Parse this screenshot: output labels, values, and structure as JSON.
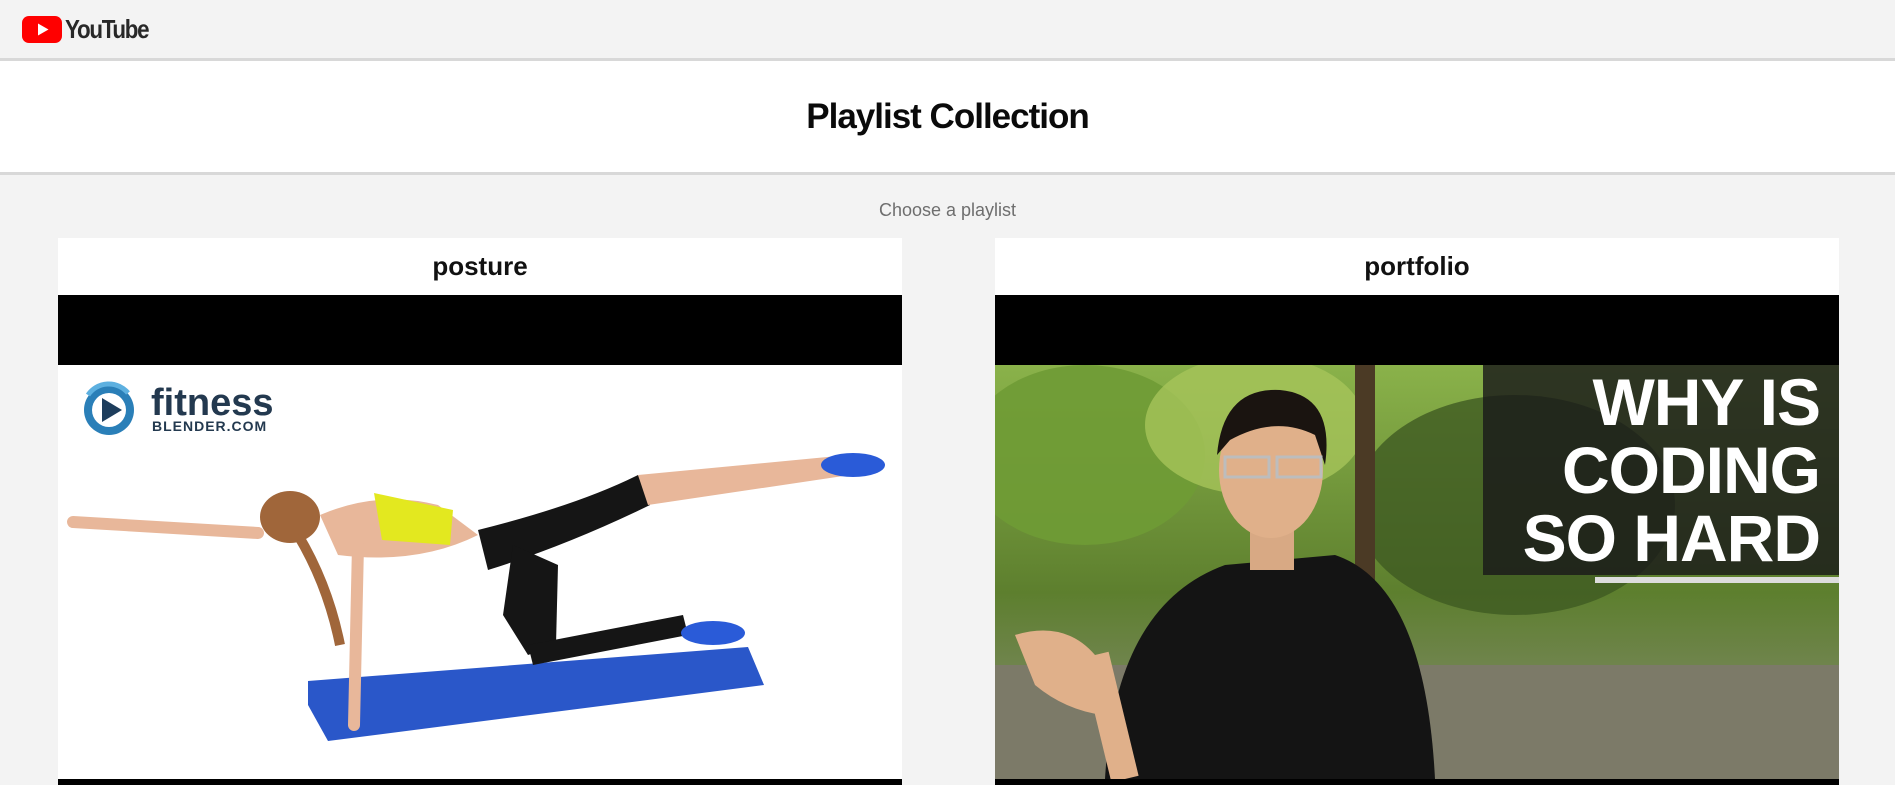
{
  "header": {
    "logo_text": "YouTube",
    "logo_icon": "youtube-play-icon",
    "brand_color": "#ff0000"
  },
  "page": {
    "title": "Playlist Collection",
    "subtitle": "Choose a playlist"
  },
  "playlists": [
    {
      "title": "posture",
      "thumbnail": {
        "brand_main": "fitness",
        "brand_sub": "BLENDER.COM"
      }
    },
    {
      "title": "portfolio",
      "thumbnail": {
        "caption_lines": [
          "WHY IS",
          "CODING",
          "SO HARD"
        ]
      }
    }
  ]
}
